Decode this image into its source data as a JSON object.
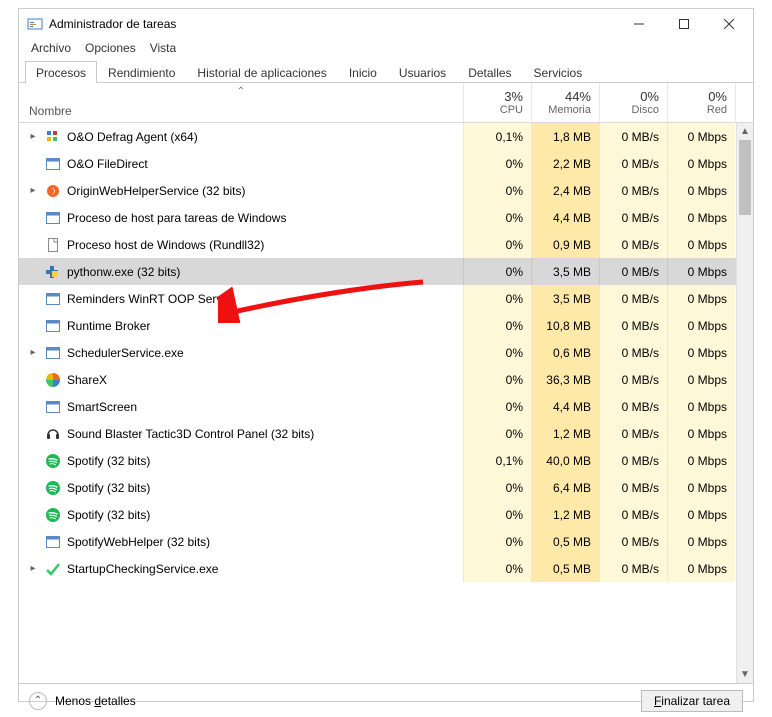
{
  "window": {
    "title": "Administrador de tareas"
  },
  "menu": {
    "file": "Archivo",
    "options": "Opciones",
    "view": "Vista"
  },
  "tabs": {
    "processes": "Procesos",
    "performance": "Rendimiento",
    "history": "Historial de aplicaciones",
    "startup": "Inicio",
    "users": "Usuarios",
    "details": "Detalles",
    "services": "Servicios",
    "active": "processes"
  },
  "columns": {
    "name": "Nombre",
    "cpu": {
      "value": "3%",
      "label": "CPU"
    },
    "memory": {
      "value": "44%",
      "label": "Memoria"
    },
    "disk": {
      "value": "0%",
      "label": "Disco"
    },
    "network": {
      "value": "0%",
      "label": "Red"
    }
  },
  "processes": [
    {
      "expandable": true,
      "icon": "defrag",
      "name": "O&O Defrag Agent (x64)",
      "cpu": "0,1%",
      "mem": "1,8 MB",
      "disk": "0 MB/s",
      "net": "0 Mbps",
      "selected": false
    },
    {
      "expandable": false,
      "icon": "window",
      "name": "O&O FileDirect",
      "cpu": "0%",
      "mem": "2,2 MB",
      "disk": "0 MB/s",
      "net": "0 Mbps",
      "selected": false
    },
    {
      "expandable": true,
      "icon": "origin",
      "name": "OriginWebHelperService (32 bits)",
      "cpu": "0%",
      "mem": "2,4 MB",
      "disk": "0 MB/s",
      "net": "0 Mbps",
      "selected": false
    },
    {
      "expandable": false,
      "icon": "window",
      "name": "Proceso de host para tareas de Windows",
      "cpu": "0%",
      "mem": "4,4 MB",
      "disk": "0 MB/s",
      "net": "0 Mbps",
      "selected": false
    },
    {
      "expandable": false,
      "icon": "page",
      "name": "Proceso host de Windows (Rundll32)",
      "cpu": "0%",
      "mem": "0,9 MB",
      "disk": "0 MB/s",
      "net": "0 Mbps",
      "selected": false
    },
    {
      "expandable": false,
      "icon": "python",
      "name": "pythonw.exe (32 bits)",
      "cpu": "0%",
      "mem": "3,5 MB",
      "disk": "0 MB/s",
      "net": "0 Mbps",
      "selected": true
    },
    {
      "expandable": false,
      "icon": "window",
      "name": "Reminders WinRT OOP Server",
      "cpu": "0%",
      "mem": "3,5 MB",
      "disk": "0 MB/s",
      "net": "0 Mbps",
      "selected": false
    },
    {
      "expandable": false,
      "icon": "window",
      "name": "Runtime Broker",
      "cpu": "0%",
      "mem": "10,8 MB",
      "disk": "0 MB/s",
      "net": "0 Mbps",
      "selected": false
    },
    {
      "expandable": true,
      "icon": "window",
      "name": "SchedulerService.exe",
      "cpu": "0%",
      "mem": "0,6 MB",
      "disk": "0 MB/s",
      "net": "0 Mbps",
      "selected": false
    },
    {
      "expandable": false,
      "icon": "sharex",
      "name": "ShareX",
      "cpu": "0%",
      "mem": "36,3 MB",
      "disk": "0 MB/s",
      "net": "0 Mbps",
      "selected": false
    },
    {
      "expandable": false,
      "icon": "window",
      "name": "SmartScreen",
      "cpu": "0%",
      "mem": "4,4 MB",
      "disk": "0 MB/s",
      "net": "0 Mbps",
      "selected": false
    },
    {
      "expandable": false,
      "icon": "headset",
      "name": "Sound Blaster Tactic3D Control Panel (32 bits)",
      "cpu": "0%",
      "mem": "1,2 MB",
      "disk": "0 MB/s",
      "net": "0 Mbps",
      "selected": false
    },
    {
      "expandable": false,
      "icon": "spotify",
      "name": "Spotify (32 bits)",
      "cpu": "0,1%",
      "mem": "40,0 MB",
      "disk": "0 MB/s",
      "net": "0 Mbps",
      "selected": false
    },
    {
      "expandable": false,
      "icon": "spotify",
      "name": "Spotify (32 bits)",
      "cpu": "0%",
      "mem": "6,4 MB",
      "disk": "0 MB/s",
      "net": "0 Mbps",
      "selected": false
    },
    {
      "expandable": false,
      "icon": "spotify",
      "name": "Spotify (32 bits)",
      "cpu": "0%",
      "mem": "1,2 MB",
      "disk": "0 MB/s",
      "net": "0 Mbps",
      "selected": false
    },
    {
      "expandable": false,
      "icon": "window",
      "name": "SpotifyWebHelper (32 bits)",
      "cpu": "0%",
      "mem": "0,5 MB",
      "disk": "0 MB/s",
      "net": "0 Mbps",
      "selected": false
    },
    {
      "expandable": true,
      "icon": "check",
      "name": "StartupCheckingService.exe",
      "cpu": "0%",
      "mem": "0,5 MB",
      "disk": "0 MB/s",
      "net": "0 Mbps",
      "selected": false
    }
  ],
  "footer": {
    "less_details": "Menos detalles",
    "end_task": "Finalizar tarea"
  },
  "annotation": {
    "arrow_color": "#e11"
  }
}
